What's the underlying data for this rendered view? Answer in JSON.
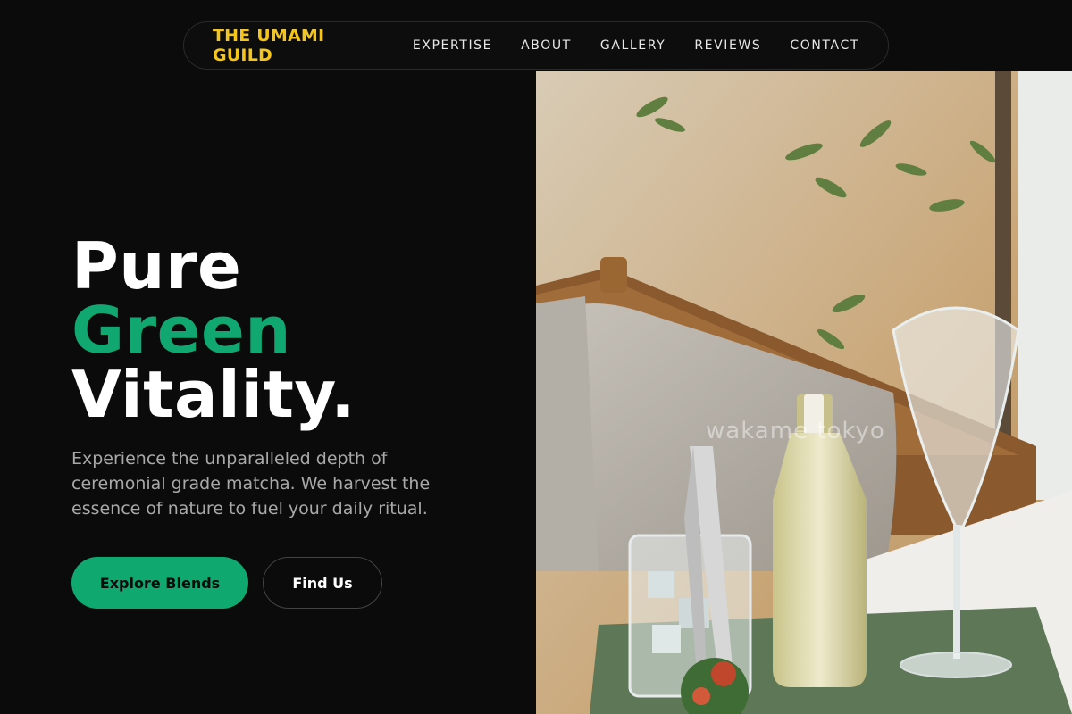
{
  "nav": {
    "brand": "THE UMAMI GUILD",
    "links": [
      "EXPERTISE",
      "ABOUT",
      "GALLERY",
      "REVIEWS",
      "CONTACT"
    ]
  },
  "hero": {
    "line1": "Pure",
    "line2": "Green",
    "line3": "Vitality.",
    "description": "Experience the unparalleled depth of ceremonial grade matcha. We harvest the essence of nature to fuel your daily ritual.",
    "primary_button": "Explore Blends",
    "secondary_button": "Find Us"
  },
  "image": {
    "watermark": "wakame tokyo"
  },
  "colors": {
    "brand": "#f5c518",
    "accent": "#10a870",
    "background": "#0b0b0b"
  }
}
